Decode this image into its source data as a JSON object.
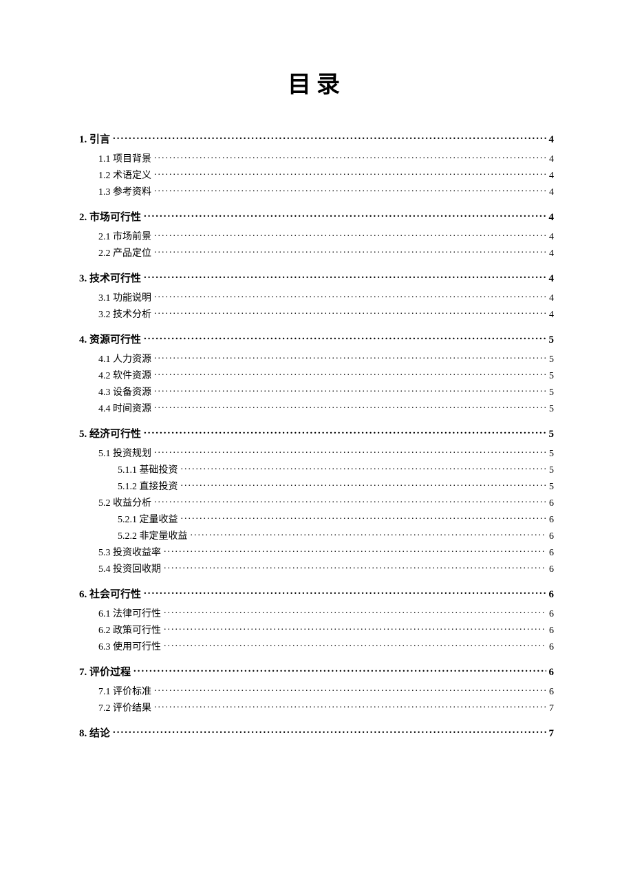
{
  "title": "目录",
  "entries": [
    {
      "level": 1,
      "label": "1. 引言",
      "page": "4"
    },
    {
      "level": 2,
      "label": "1.1 项目背景",
      "page": "4"
    },
    {
      "level": 2,
      "label": "1.2 术语定义",
      "page": "4"
    },
    {
      "level": 2,
      "label": "1.3 参考资料",
      "page": "4"
    },
    {
      "level": 1,
      "label": "2. 市场可行性",
      "page": "4"
    },
    {
      "level": 2,
      "label": "2.1 市场前景",
      "page": "4"
    },
    {
      "level": 2,
      "label": "2.2 产品定位",
      "page": "4"
    },
    {
      "level": 1,
      "label": "3. 技术可行性",
      "page": "4"
    },
    {
      "level": 2,
      "label": "3.1 功能说明",
      "page": "4"
    },
    {
      "level": 2,
      "label": "3.2 技术分析",
      "page": "4"
    },
    {
      "level": 1,
      "label": "4. 资源可行性",
      "page": "5"
    },
    {
      "level": 2,
      "label": "4.1 人力资源",
      "page": "5"
    },
    {
      "level": 2,
      "label": "4.2 软件资源",
      "page": "5"
    },
    {
      "level": 2,
      "label": "4.3 设备资源",
      "page": "5"
    },
    {
      "level": 2,
      "label": "4.4 时间资源",
      "page": "5"
    },
    {
      "level": 1,
      "label": "5. 经济可行性",
      "page": "5"
    },
    {
      "level": 2,
      "label": "5.1 投资规划",
      "page": "5"
    },
    {
      "level": 3,
      "label": "5.1.1 基础投资",
      "page": "5"
    },
    {
      "level": 3,
      "label": "5.1.2 直接投资",
      "page": "5"
    },
    {
      "level": 2,
      "label": "5.2 收益分析",
      "page": "6"
    },
    {
      "level": 3,
      "label": "5.2.1 定量收益",
      "page": "6"
    },
    {
      "level": 3,
      "label": "5.2.2 非定量收益",
      "page": "6"
    },
    {
      "level": 2,
      "label": "5.3 投资收益率",
      "page": "6"
    },
    {
      "level": 2,
      "label": "5.4 投资回收期",
      "page": "6"
    },
    {
      "level": 1,
      "label": "6. 社会可行性",
      "page": "6"
    },
    {
      "level": 2,
      "label": "6.1 法律可行性",
      "page": "6"
    },
    {
      "level": 2,
      "label": "6.2 政策可行性",
      "page": "6"
    },
    {
      "level": 2,
      "label": "6.3 使用可行性",
      "page": "6"
    },
    {
      "level": 1,
      "label": "7. 评价过程",
      "page": "6"
    },
    {
      "level": 2,
      "label": "7.1 评价标准",
      "page": "6"
    },
    {
      "level": 2,
      "label": "7.2 评价结果",
      "page": "7"
    },
    {
      "level": 1,
      "label": "8. 结论",
      "page": "7"
    }
  ]
}
